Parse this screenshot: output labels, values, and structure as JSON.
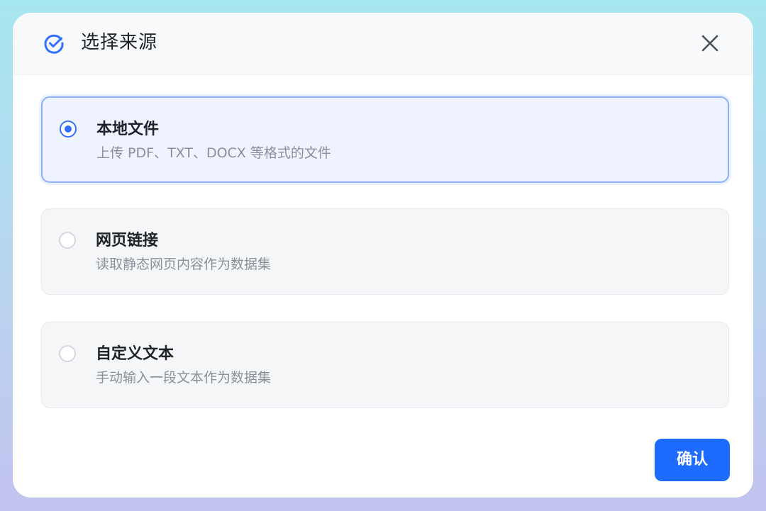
{
  "dialog": {
    "title": "选择来源",
    "icon": "check-circle-icon",
    "close_icon": "close-icon"
  },
  "options": [
    {
      "title": "本地文件",
      "description": "上传 PDF、TXT、DOCX 等格式的文件",
      "selected": true
    },
    {
      "title": "网页链接",
      "description": "读取静态网页内容作为数据集",
      "selected": false
    },
    {
      "title": "自定义文本",
      "description": "手动输入一段文本作为数据集",
      "selected": false
    }
  ],
  "footer": {
    "confirm_label": "确认"
  },
  "colors": {
    "accent": "#1d6bff",
    "selected_bg": "#eef3ff",
    "selected_border": "#8fb0f7"
  }
}
